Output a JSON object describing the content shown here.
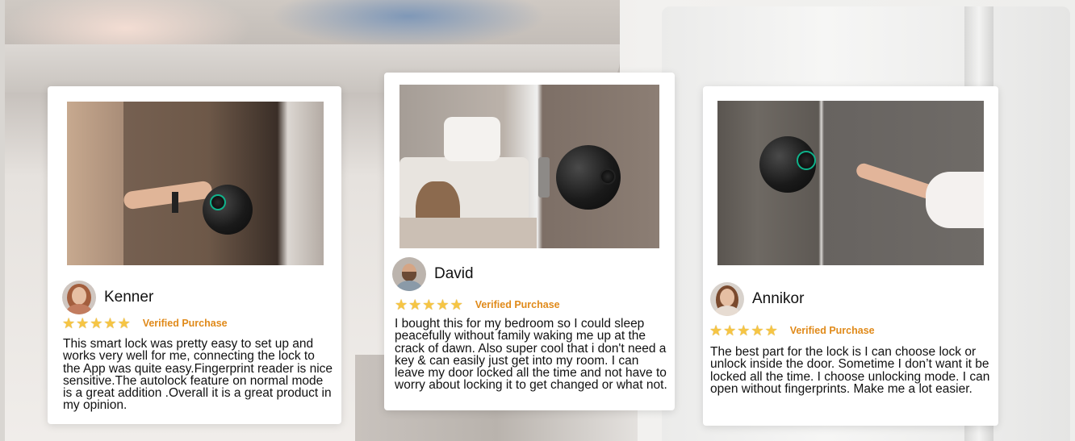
{
  "reviews": [
    {
      "name": "Kenner",
      "stars": 5,
      "verified_label": "Verified Purchase",
      "text": "This smart lock was pretty easy to set up and works very well for me, connecting the lock to the App was quite easy.Fingerprint reader is nice sensitive.The autolock feature on normal mode is a great addition .Overall it is a great product in my opinion."
    },
    {
      "name": "David",
      "stars": 5,
      "verified_label": "Verified Purchase",
      "text": "I bought this for my bedroom so I could sleep peacefully without family waking me up at the crack of dawn. Also super cool that i don't need a key & can easily just get into my room. I can leave my door locked all the time and not have to worry about locking it to get changed or what not."
    },
    {
      "name": "Annikor",
      "stars": 5,
      "verified_label": "Verified Purchase",
      "text": "The best part for the lock is I can choose lock or unlock inside the door. Sometime I don’t want it be locked all the time. I choose unlocking mode. I can open without fingerprints. Make me a lot easier."
    }
  ],
  "icons": {
    "star": "star-icon",
    "avatar": "avatar"
  },
  "colors": {
    "verified": "#e08a1a",
    "star": "#f6c544",
    "sensor_ring": "#0fb38b"
  }
}
